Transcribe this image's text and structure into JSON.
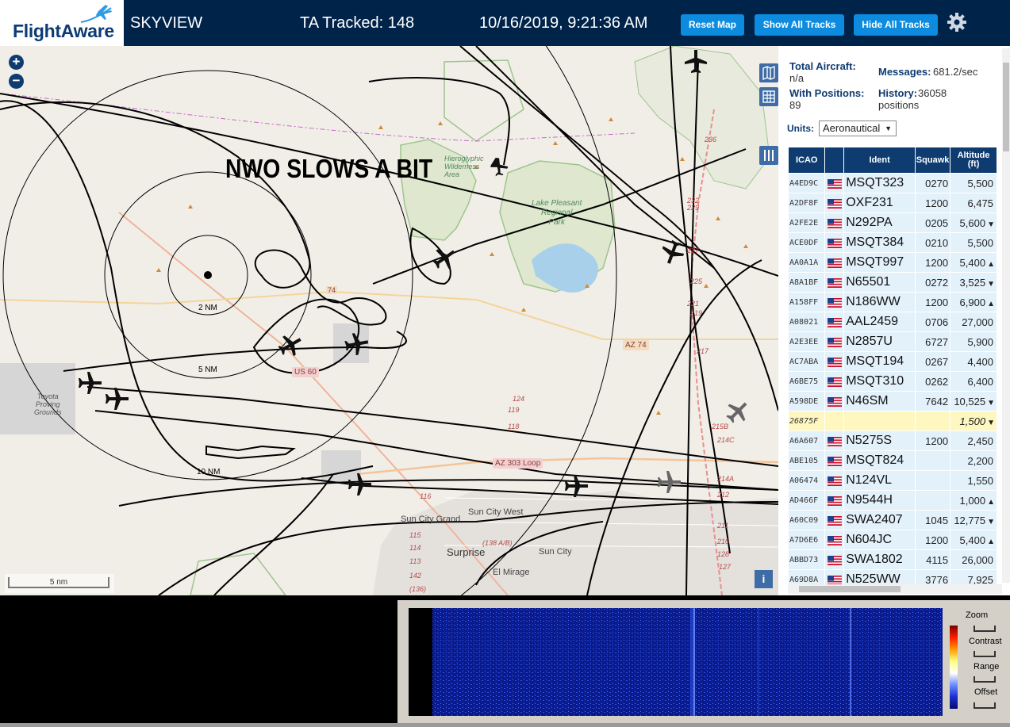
{
  "header": {
    "logo_text": "FlightAware",
    "app_title": "SKYVIEW",
    "tracked": "TA Tracked: 148",
    "datetime": "10/16/2019, 9:21:36 AM",
    "buttons": {
      "reset": "Reset Map",
      "show": "Show All Tracks",
      "hide": "Hide All Tracks"
    },
    "settings_icon": "gear-icon"
  },
  "map": {
    "annotation": "NWO SLOWS A BIT",
    "zoom_in": "+",
    "zoom_out": "−",
    "scale": "5 nm",
    "info": "i",
    "range_labels": [
      "2 NM",
      "5 NM",
      "10 NM"
    ],
    "place_labels": {
      "lake": "Lake Pleasant\nRegional\nPark",
      "sun_city_grand": "Sun City Grand",
      "sun_city_west": "Sun City West",
      "surprise": "Surprise",
      "sun_city": "Sun City",
      "el_mirage": "El Mirage",
      "toyota": "Toyota\nProving\nGrounds",
      "az303": "AZ 303 Loop",
      "us60": "US 60",
      "az74": "AZ 74",
      "wilderness": "Hieroglyphic\nWilderness\nArea",
      "rt_74": "74"
    },
    "road_numbers": [
      "236",
      "232",
      "229",
      "227",
      "225",
      "221",
      "219",
      "217",
      "215B",
      "214C",
      "214A",
      "212",
      "211",
      "210",
      "128",
      "127",
      "124",
      "119",
      "118",
      "116",
      "115",
      "114",
      "113",
      "142",
      "(136)",
      "(138 A/B)"
    ]
  },
  "sidebar": {
    "total_aircraft_label": "Total Aircraft:",
    "total_aircraft_value": "n/a",
    "messages_label": "Messages:",
    "messages_value": "681.2/sec",
    "with_positions_label": "With Positions:",
    "with_positions_value": "89",
    "history_label": "History:",
    "history_value": "36058 positions",
    "units_label": "Units:",
    "units_value": "Aeronautical",
    "columns": {
      "icao": "ICAO",
      "ident": "Ident",
      "squawk": "Squawk",
      "altitude": "Altitude (ft)"
    },
    "rows": [
      {
        "icao": "A4ED9C",
        "flag": true,
        "ident": "MSQT323",
        "squawk": "0270",
        "alt": "5,500",
        "trend": ""
      },
      {
        "icao": "A2DF8F",
        "flag": true,
        "ident": "OXF231",
        "squawk": "1200",
        "alt": "6,475",
        "trend": ""
      },
      {
        "icao": "A2FE2E",
        "flag": true,
        "ident": "N292PA",
        "squawk": "0205",
        "alt": "5,600",
        "trend": "▼"
      },
      {
        "icao": "ACE0DF",
        "flag": true,
        "ident": "MSQT384",
        "squawk": "0210",
        "alt": "5,500",
        "trend": ""
      },
      {
        "icao": "AA0A1A",
        "flag": true,
        "ident": "MSQT997",
        "squawk": "1200",
        "alt": "5,400",
        "trend": "▲"
      },
      {
        "icao": "A8A1BF",
        "flag": true,
        "ident": "N65501",
        "squawk": "0272",
        "alt": "3,525",
        "trend": "▼"
      },
      {
        "icao": "A158FF",
        "flag": true,
        "ident": "N186WW",
        "squawk": "1200",
        "alt": "6,900",
        "trend": "▲"
      },
      {
        "icao": "A08021",
        "flag": true,
        "ident": "AAL2459",
        "squawk": "0706",
        "alt": "27,000",
        "trend": ""
      },
      {
        "icao": "A2E3EE",
        "flag": true,
        "ident": "N2857U",
        "squawk": "6727",
        "alt": "5,900",
        "trend": ""
      },
      {
        "icao": "AC7ABA",
        "flag": true,
        "ident": "MSQT194",
        "squawk": "0267",
        "alt": "4,400",
        "trend": ""
      },
      {
        "icao": "A6BE75",
        "flag": true,
        "ident": "MSQT310",
        "squawk": "0262",
        "alt": "6,400",
        "trend": ""
      },
      {
        "icao": "A598DE",
        "flag": true,
        "ident": "N46SM",
        "squawk": "7642",
        "alt": "10,525",
        "trend": "▼"
      },
      {
        "icao": "26875F",
        "flag": false,
        "ident": "",
        "squawk": "",
        "alt": "1,500",
        "trend": "▼",
        "selected": true
      },
      {
        "icao": "A6A607",
        "flag": true,
        "ident": "N5275S",
        "squawk": "1200",
        "alt": "2,450",
        "trend": ""
      },
      {
        "icao": "ABE105",
        "flag": true,
        "ident": "MSQT824",
        "squawk": "",
        "alt": "2,200",
        "trend": ""
      },
      {
        "icao": "A06474",
        "flag": true,
        "ident": "N124VL",
        "squawk": "",
        "alt": "1,550",
        "trend": ""
      },
      {
        "icao": "AD466F",
        "flag": true,
        "ident": "N9544H",
        "squawk": "",
        "alt": "1,000",
        "trend": "▲"
      },
      {
        "icao": "A60C09",
        "flag": true,
        "ident": "SWA2407",
        "squawk": "1045",
        "alt": "12,775",
        "trend": "▼"
      },
      {
        "icao": "A7D6E6",
        "flag": true,
        "ident": "N604JC",
        "squawk": "1200",
        "alt": "5,400",
        "trend": "▲"
      },
      {
        "icao": "ABBD73",
        "flag": true,
        "ident": "SWA1802",
        "squawk": "4115",
        "alt": "26,000",
        "trend": ""
      },
      {
        "icao": "A69D8A",
        "flag": true,
        "ident": "N525WW",
        "squawk": "3776",
        "alt": "7,925",
        "trend": ""
      }
    ]
  },
  "spectrogram": {
    "zoom": "Zoom",
    "contrast": "Contrast",
    "range": "Range",
    "offset": "Offset"
  },
  "colors": {
    "header_bg": "#00234a",
    "button_bg": "#0d8bde",
    "table_header": "#0f3c70",
    "row_bg": "#e3f1fb",
    "selected_row": "#fff7c0",
    "map_bg": "#f1eee8"
  }
}
